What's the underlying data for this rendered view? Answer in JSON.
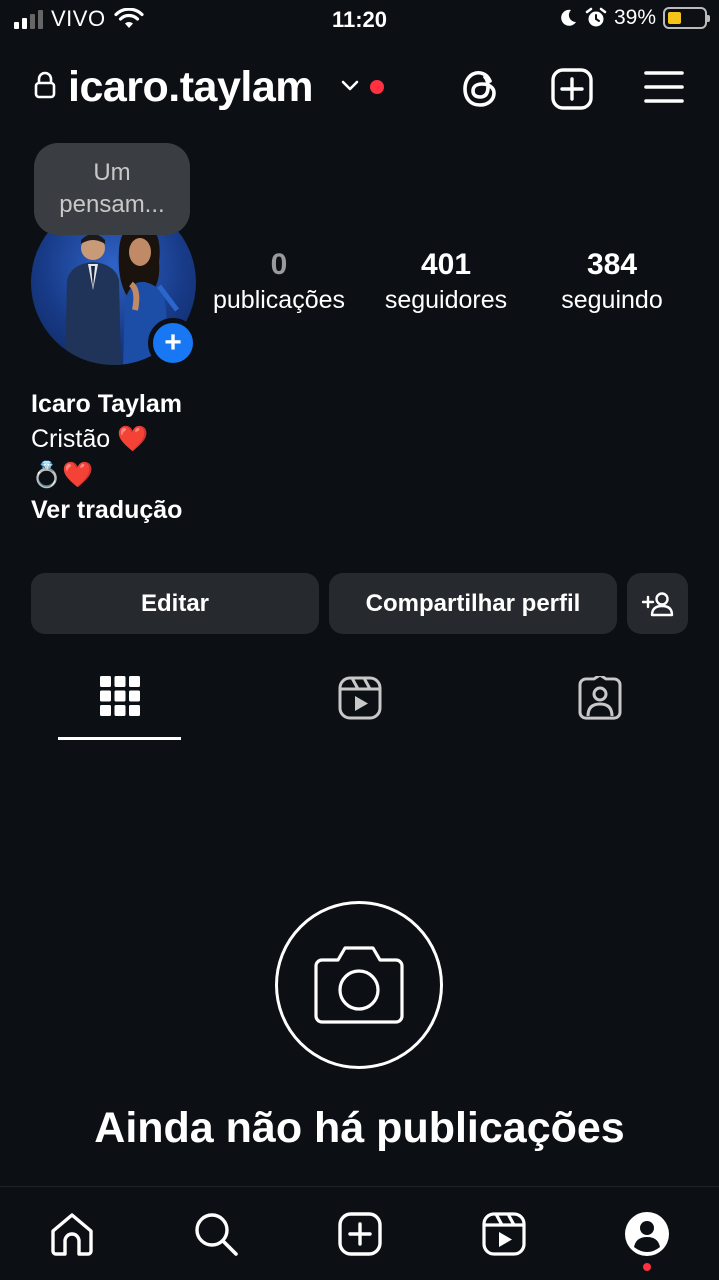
{
  "status_bar": {
    "carrier": "VIVO",
    "time": "11:20",
    "battery_percent": "39%",
    "battery_level": 0.39
  },
  "header": {
    "username": "icaro.taylam"
  },
  "profile": {
    "note": "Um pensam...",
    "stats": {
      "posts": {
        "value": "0",
        "label": "publicações"
      },
      "followers": {
        "value": "401",
        "label": "seguidores"
      },
      "following": {
        "value": "384",
        "label": "seguindo"
      }
    },
    "full_name": "Icaro Taylam",
    "bio_line1": "Cristão ❤️",
    "bio_line2": "💍❤️",
    "translate_label": "Ver tradução"
  },
  "buttons": {
    "edit": "Editar",
    "share": "Compartilhar perfil"
  },
  "tabs": [
    "grid",
    "reels",
    "tagged"
  ],
  "empty_state": {
    "title": "Ainda não há publicações"
  },
  "colors": {
    "background": "#0c1014",
    "button_bg": "#26292e",
    "accent_blue": "#1877f2",
    "notification_red": "#ff3040"
  }
}
